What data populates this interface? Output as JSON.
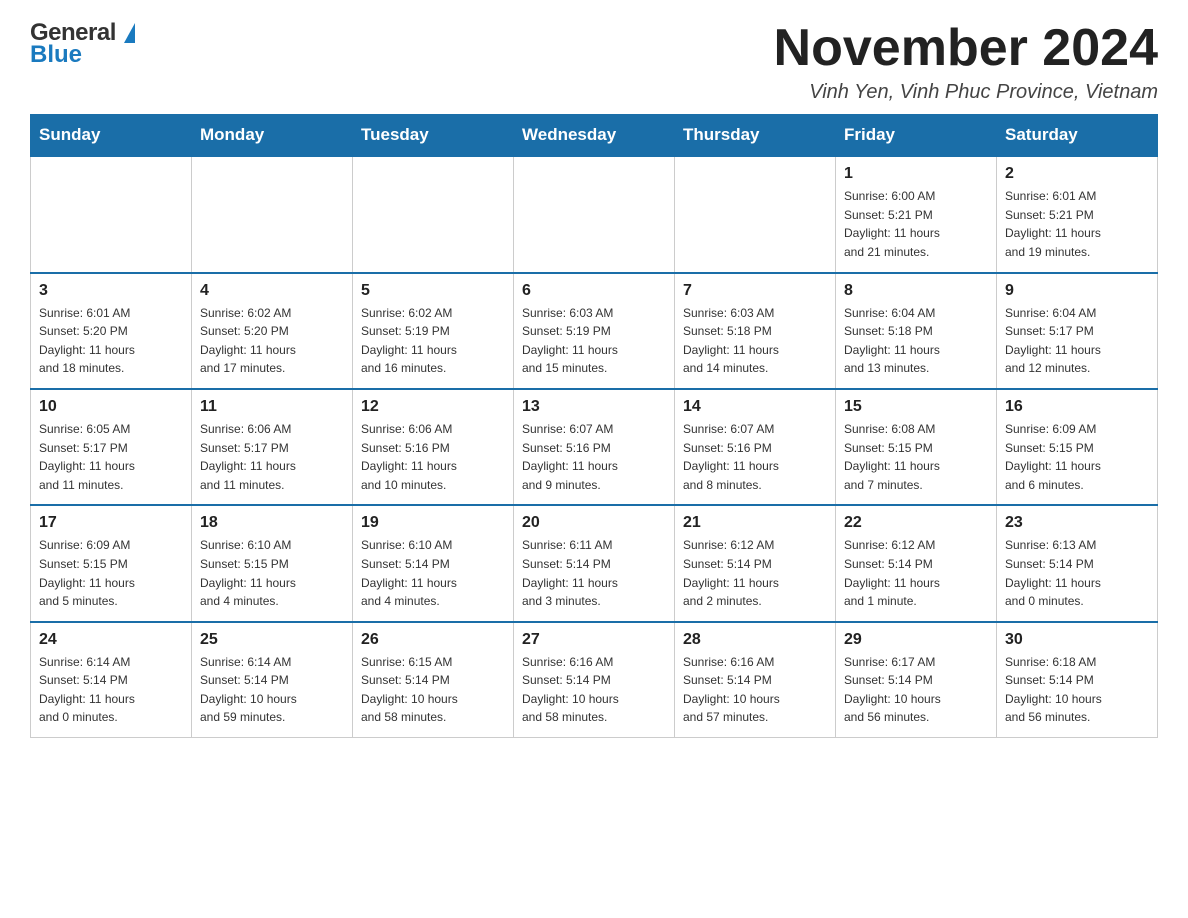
{
  "header": {
    "logo_general": "General",
    "logo_blue": "Blue",
    "month_title": "November 2024",
    "location": "Vinh Yen, Vinh Phuc Province, Vietnam"
  },
  "calendar": {
    "days_of_week": [
      "Sunday",
      "Monday",
      "Tuesday",
      "Wednesday",
      "Thursday",
      "Friday",
      "Saturday"
    ],
    "weeks": [
      [
        {
          "day": "",
          "info": ""
        },
        {
          "day": "",
          "info": ""
        },
        {
          "day": "",
          "info": ""
        },
        {
          "day": "",
          "info": ""
        },
        {
          "day": "",
          "info": ""
        },
        {
          "day": "1",
          "info": "Sunrise: 6:00 AM\nSunset: 5:21 PM\nDaylight: 11 hours\nand 21 minutes."
        },
        {
          "day": "2",
          "info": "Sunrise: 6:01 AM\nSunset: 5:21 PM\nDaylight: 11 hours\nand 19 minutes."
        }
      ],
      [
        {
          "day": "3",
          "info": "Sunrise: 6:01 AM\nSunset: 5:20 PM\nDaylight: 11 hours\nand 18 minutes."
        },
        {
          "day": "4",
          "info": "Sunrise: 6:02 AM\nSunset: 5:20 PM\nDaylight: 11 hours\nand 17 minutes."
        },
        {
          "day": "5",
          "info": "Sunrise: 6:02 AM\nSunset: 5:19 PM\nDaylight: 11 hours\nand 16 minutes."
        },
        {
          "day": "6",
          "info": "Sunrise: 6:03 AM\nSunset: 5:19 PM\nDaylight: 11 hours\nand 15 minutes."
        },
        {
          "day": "7",
          "info": "Sunrise: 6:03 AM\nSunset: 5:18 PM\nDaylight: 11 hours\nand 14 minutes."
        },
        {
          "day": "8",
          "info": "Sunrise: 6:04 AM\nSunset: 5:18 PM\nDaylight: 11 hours\nand 13 minutes."
        },
        {
          "day": "9",
          "info": "Sunrise: 6:04 AM\nSunset: 5:17 PM\nDaylight: 11 hours\nand 12 minutes."
        }
      ],
      [
        {
          "day": "10",
          "info": "Sunrise: 6:05 AM\nSunset: 5:17 PM\nDaylight: 11 hours\nand 11 minutes."
        },
        {
          "day": "11",
          "info": "Sunrise: 6:06 AM\nSunset: 5:17 PM\nDaylight: 11 hours\nand 11 minutes."
        },
        {
          "day": "12",
          "info": "Sunrise: 6:06 AM\nSunset: 5:16 PM\nDaylight: 11 hours\nand 10 minutes."
        },
        {
          "day": "13",
          "info": "Sunrise: 6:07 AM\nSunset: 5:16 PM\nDaylight: 11 hours\nand 9 minutes."
        },
        {
          "day": "14",
          "info": "Sunrise: 6:07 AM\nSunset: 5:16 PM\nDaylight: 11 hours\nand 8 minutes."
        },
        {
          "day": "15",
          "info": "Sunrise: 6:08 AM\nSunset: 5:15 PM\nDaylight: 11 hours\nand 7 minutes."
        },
        {
          "day": "16",
          "info": "Sunrise: 6:09 AM\nSunset: 5:15 PM\nDaylight: 11 hours\nand 6 minutes."
        }
      ],
      [
        {
          "day": "17",
          "info": "Sunrise: 6:09 AM\nSunset: 5:15 PM\nDaylight: 11 hours\nand 5 minutes."
        },
        {
          "day": "18",
          "info": "Sunrise: 6:10 AM\nSunset: 5:15 PM\nDaylight: 11 hours\nand 4 minutes."
        },
        {
          "day": "19",
          "info": "Sunrise: 6:10 AM\nSunset: 5:14 PM\nDaylight: 11 hours\nand 4 minutes."
        },
        {
          "day": "20",
          "info": "Sunrise: 6:11 AM\nSunset: 5:14 PM\nDaylight: 11 hours\nand 3 minutes."
        },
        {
          "day": "21",
          "info": "Sunrise: 6:12 AM\nSunset: 5:14 PM\nDaylight: 11 hours\nand 2 minutes."
        },
        {
          "day": "22",
          "info": "Sunrise: 6:12 AM\nSunset: 5:14 PM\nDaylight: 11 hours\nand 1 minute."
        },
        {
          "day": "23",
          "info": "Sunrise: 6:13 AM\nSunset: 5:14 PM\nDaylight: 11 hours\nand 0 minutes."
        }
      ],
      [
        {
          "day": "24",
          "info": "Sunrise: 6:14 AM\nSunset: 5:14 PM\nDaylight: 11 hours\nand 0 minutes."
        },
        {
          "day": "25",
          "info": "Sunrise: 6:14 AM\nSunset: 5:14 PM\nDaylight: 10 hours\nand 59 minutes."
        },
        {
          "day": "26",
          "info": "Sunrise: 6:15 AM\nSunset: 5:14 PM\nDaylight: 10 hours\nand 58 minutes."
        },
        {
          "day": "27",
          "info": "Sunrise: 6:16 AM\nSunset: 5:14 PM\nDaylight: 10 hours\nand 58 minutes."
        },
        {
          "day": "28",
          "info": "Sunrise: 6:16 AM\nSunset: 5:14 PM\nDaylight: 10 hours\nand 57 minutes."
        },
        {
          "day": "29",
          "info": "Sunrise: 6:17 AM\nSunset: 5:14 PM\nDaylight: 10 hours\nand 56 minutes."
        },
        {
          "day": "30",
          "info": "Sunrise: 6:18 AM\nSunset: 5:14 PM\nDaylight: 10 hours\nand 56 minutes."
        }
      ]
    ]
  }
}
